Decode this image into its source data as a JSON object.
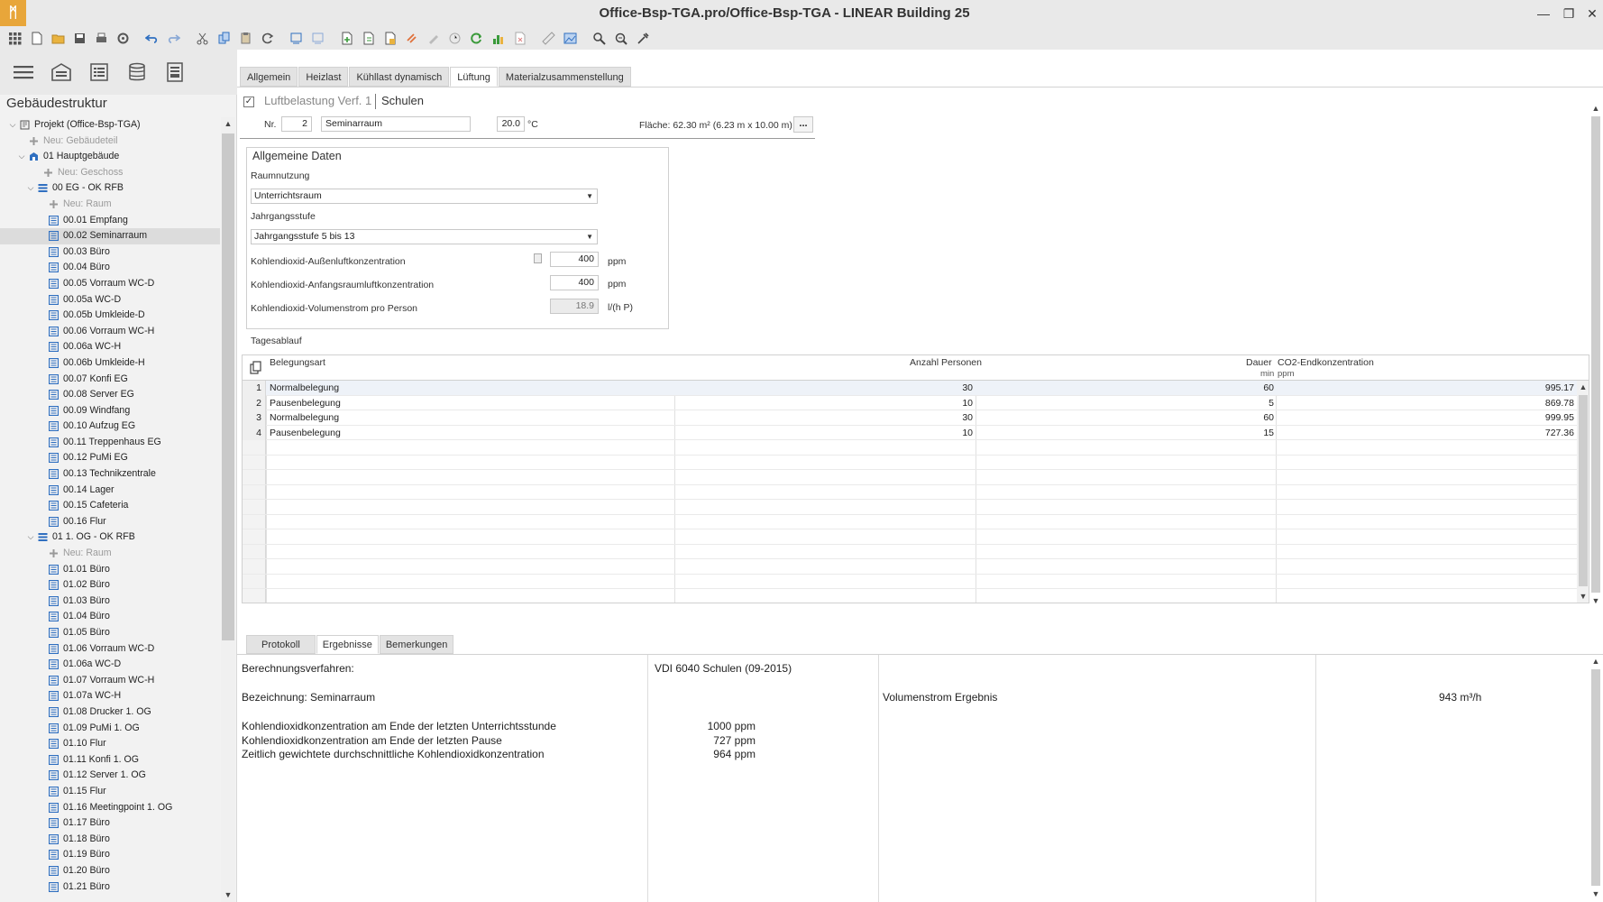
{
  "window": {
    "title": "Office-Bsp-TGA.pro/Office-Bsp-TGA - LINEAR Building 25",
    "logo": "ᛗ"
  },
  "toolbar": {
    "icons": [
      "apps-grid-icon",
      "new-file-icon",
      "open-folder-icon",
      "save-icon",
      "print-icon",
      "settings-icon",
      "undo-icon",
      "redo-icon",
      "cut-icon",
      "copy-icon",
      "paste-icon",
      "refresh-icon",
      "import-icon",
      "export-icon",
      "add-doc-icon",
      "copy-doc-icon",
      "report-icon",
      "link-icon",
      "pencil-icon",
      "clock-icon",
      "sync-icon",
      "chart-icon",
      "delete-doc-icon",
      "ruler-icon",
      "image-icon",
      "zoom-icon",
      "zoom-fit-icon",
      "pipette-icon"
    ]
  },
  "sidebar": {
    "title": "Gebäudestruktur",
    "tree": [
      {
        "label": "Projekt (Office-Bsp-TGA)",
        "level": 0,
        "type": "project",
        "expanded": true
      },
      {
        "label": "Neu: Gebäudeteil",
        "level": 1,
        "type": "new"
      },
      {
        "label": "01 Hauptgebäude",
        "level": 1,
        "type": "building",
        "expanded": true
      },
      {
        "label": "Neu: Geschoss",
        "level": 2,
        "type": "new"
      },
      {
        "label": "00 EG - OK RFB",
        "level": 2,
        "type": "floor",
        "expanded": true
      },
      {
        "label": "Neu: Raum",
        "level": 3,
        "type": "new"
      },
      {
        "label": "00.01 Empfang",
        "level": 3,
        "type": "room"
      },
      {
        "label": "00.02 Seminarraum",
        "level": 3,
        "type": "room",
        "selected": true
      },
      {
        "label": "00.03 Büro",
        "level": 3,
        "type": "room"
      },
      {
        "label": "00.04 Büro",
        "level": 3,
        "type": "room"
      },
      {
        "label": "00.05 Vorraum WC-D",
        "level": 3,
        "type": "room"
      },
      {
        "label": "00.05a WC-D",
        "level": 3,
        "type": "room"
      },
      {
        "label": "00.05b Umkleide-D",
        "level": 3,
        "type": "room"
      },
      {
        "label": "00.06 Vorraum WC-H",
        "level": 3,
        "type": "room"
      },
      {
        "label": "00.06a WC-H",
        "level": 3,
        "type": "room"
      },
      {
        "label": "00.06b Umkleide-H",
        "level": 3,
        "type": "room"
      },
      {
        "label": "00.07 Konfi EG",
        "level": 3,
        "type": "room"
      },
      {
        "label": "00.08 Server EG",
        "level": 3,
        "type": "room"
      },
      {
        "label": "00.09 Windfang",
        "level": 3,
        "type": "room"
      },
      {
        "label": "00.10 Aufzug EG",
        "level": 3,
        "type": "room"
      },
      {
        "label": "00.11 Treppenhaus EG",
        "level": 3,
        "type": "room"
      },
      {
        "label": "00.12 PuMi EG",
        "level": 3,
        "type": "room"
      },
      {
        "label": "00.13 Technikzentrale",
        "level": 3,
        "type": "room"
      },
      {
        "label": "00.14 Lager",
        "level": 3,
        "type": "room"
      },
      {
        "label": "00.15 Cafeteria",
        "level": 3,
        "type": "room"
      },
      {
        "label": "00.16 Flur",
        "level": 3,
        "type": "room"
      },
      {
        "label": "01 1. OG - OK RFB",
        "level": 2,
        "type": "floor",
        "expanded": true
      },
      {
        "label": "Neu: Raum",
        "level": 3,
        "type": "new"
      },
      {
        "label": "01.01 Büro",
        "level": 3,
        "type": "room"
      },
      {
        "label": "01.02 Büro",
        "level": 3,
        "type": "room"
      },
      {
        "label": "01.03 Büro",
        "level": 3,
        "type": "room"
      },
      {
        "label": "01.04 Büro",
        "level": 3,
        "type": "room"
      },
      {
        "label": "01.05 Büro",
        "level": 3,
        "type": "room"
      },
      {
        "label": "01.06 Vorraum WC-D",
        "level": 3,
        "type": "room"
      },
      {
        "label": "01.06a WC-D",
        "level": 3,
        "type": "room"
      },
      {
        "label": "01.07 Vorraum WC-H",
        "level": 3,
        "type": "room"
      },
      {
        "label": "01.07a WC-H",
        "level": 3,
        "type": "room"
      },
      {
        "label": "01.08 Drucker 1. OG",
        "level": 3,
        "type": "room"
      },
      {
        "label": "01.09 PuMi 1. OG",
        "level": 3,
        "type": "room"
      },
      {
        "label": "01.10 Flur",
        "level": 3,
        "type": "room"
      },
      {
        "label": "01.11 Konfi 1. OG",
        "level": 3,
        "type": "room"
      },
      {
        "label": "01.12 Server 1. OG",
        "level": 3,
        "type": "room"
      },
      {
        "label": "01.15 Flur",
        "level": 3,
        "type": "room"
      },
      {
        "label": "01.16 Meetingpoint 1. OG",
        "level": 3,
        "type": "room"
      },
      {
        "label": "01.17 Büro",
        "level": 3,
        "type": "room"
      },
      {
        "label": "01.18 Büro",
        "level": 3,
        "type": "room"
      },
      {
        "label": "01.19 Büro",
        "level": 3,
        "type": "room"
      },
      {
        "label": "01.20 Büro",
        "level": 3,
        "type": "room"
      },
      {
        "label": "01.21 Büro",
        "level": 3,
        "type": "room"
      }
    ]
  },
  "main": {
    "tabs": [
      "Allgemein",
      "Heizlast",
      "Kühllast dynamisch",
      "Lüftung",
      "Materialzusammenstellung"
    ],
    "active_tab": "Lüftung",
    "mode": {
      "label": "Luftbelastung Verf. 1",
      "value": "Schulen",
      "checked": true
    },
    "room": {
      "nr_label": "Nr.",
      "nr": "2",
      "name": "Seminarraum",
      "temp": "20.0",
      "temp_unit": "°C",
      "area": "Fläche: 62.30  m² (6.23 m x 10.00 m)",
      "more": "..."
    },
    "general": {
      "title": "Allgemeine Daten",
      "usage_label": "Raumnutzung",
      "usage_value": "Unterrichtsraum",
      "grade_label": "Jahrgangsstufe",
      "grade_value": "Jahrgangsstufe 5 bis 13",
      "co2_out_label": "Kohlendioxid-Außenluftkonzentration",
      "co2_out_value": "400",
      "co2_out_unit": "ppm",
      "co2_init_label": "Kohlendioxid-Anfangsraumluftkonzentration",
      "co2_init_value": "400",
      "co2_init_unit": "ppm",
      "co2_flow_label": "Kohlendioxid-Volumenstrom pro Person",
      "co2_flow_value": "18.9",
      "co2_flow_unit": "l/(h P)"
    },
    "schedule": {
      "title": "Tagesablauf",
      "headers": {
        "type": "Belegungsart",
        "persons": "Anzahl Personen",
        "duration": "Dauer",
        "duration_unit": "min",
        "co2": "CO2-Endkonzentration",
        "co2_unit": "ppm"
      },
      "rows": [
        {
          "no": "1",
          "type": "Normalbelegung",
          "persons": "30",
          "duration": "60",
          "co2": "995.17"
        },
        {
          "no": "2",
          "type": "Pausenbelegung",
          "persons": "10",
          "duration": "5",
          "co2": "869.78"
        },
        {
          "no": "3",
          "type": "Normalbelegung",
          "persons": "30",
          "duration": "60",
          "co2": "999.95"
        },
        {
          "no": "4",
          "type": "Pausenbelegung",
          "persons": "10",
          "duration": "15",
          "co2": "727.36"
        }
      ]
    },
    "bottom_tabs": [
      "Protokoll",
      "Ergebnisse",
      "Bemerkungen"
    ],
    "bottom_active": "Ergebnisse",
    "results": {
      "method_label": "Berechnungsverfahren:",
      "method_value": "VDI 6040 Schulen (09-2015)",
      "name_label": "Bezeichnung: Seminarraum",
      "flow_label": "Volumenstrom Ergebnis",
      "flow_value": "943 m³/h",
      "lines": [
        {
          "label": "Kohlendioxidkonzentration am Ende der letzten Unterrichtsstunde",
          "value": "1000 ppm"
        },
        {
          "label": "Kohlendioxidkonzentration am Ende der letzten Pause",
          "value": "727 ppm"
        },
        {
          "label": "Zeitlich gewichtete durchschnittliche Kohlendioxidkonzentration",
          "value": "964 ppm"
        }
      ]
    }
  }
}
